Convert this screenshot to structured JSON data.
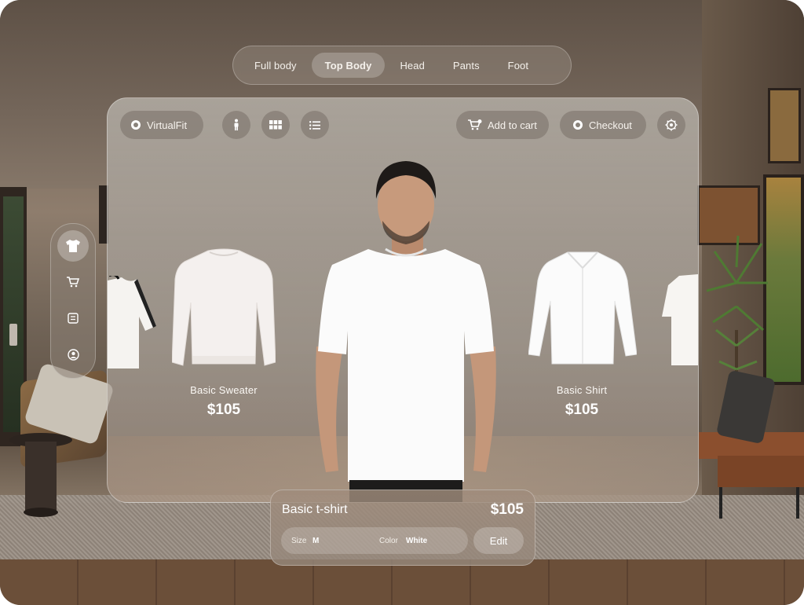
{
  "app": {
    "name": "VirtualFit"
  },
  "category_tabs": [
    {
      "label": "Full body",
      "active": false
    },
    {
      "label": "Top Body",
      "active": true
    },
    {
      "label": "Head",
      "active": false
    },
    {
      "label": "Pants",
      "active": false
    },
    {
      "label": "Foot",
      "active": false
    }
  ],
  "toolbar": {
    "brand_label": "VirtualFit",
    "view_icons": [
      "person-icon",
      "grid-icon",
      "list-icon"
    ],
    "add_to_cart_label": "Add to cart",
    "checkout_label": "Checkout",
    "settings_icon": "gear-icon"
  },
  "carousel": [
    {
      "name": "Basic Sweater",
      "price": "$105"
    },
    {
      "name": "Basic Shirt",
      "price": "$105"
    }
  ],
  "side_menu": {
    "items": [
      "tshirt-icon",
      "cart-icon",
      "notes-icon",
      "profile-icon"
    ],
    "active_index": 0
  },
  "selected_item": {
    "name": "Basic t-shirt",
    "price": "$105",
    "size_label": "Size",
    "size_value": "M",
    "color_label": "Color",
    "color_value": "White",
    "edit_label": "Edit"
  },
  "colors": {
    "accent_text": "#ffffff",
    "glass": "#b5afa8"
  }
}
